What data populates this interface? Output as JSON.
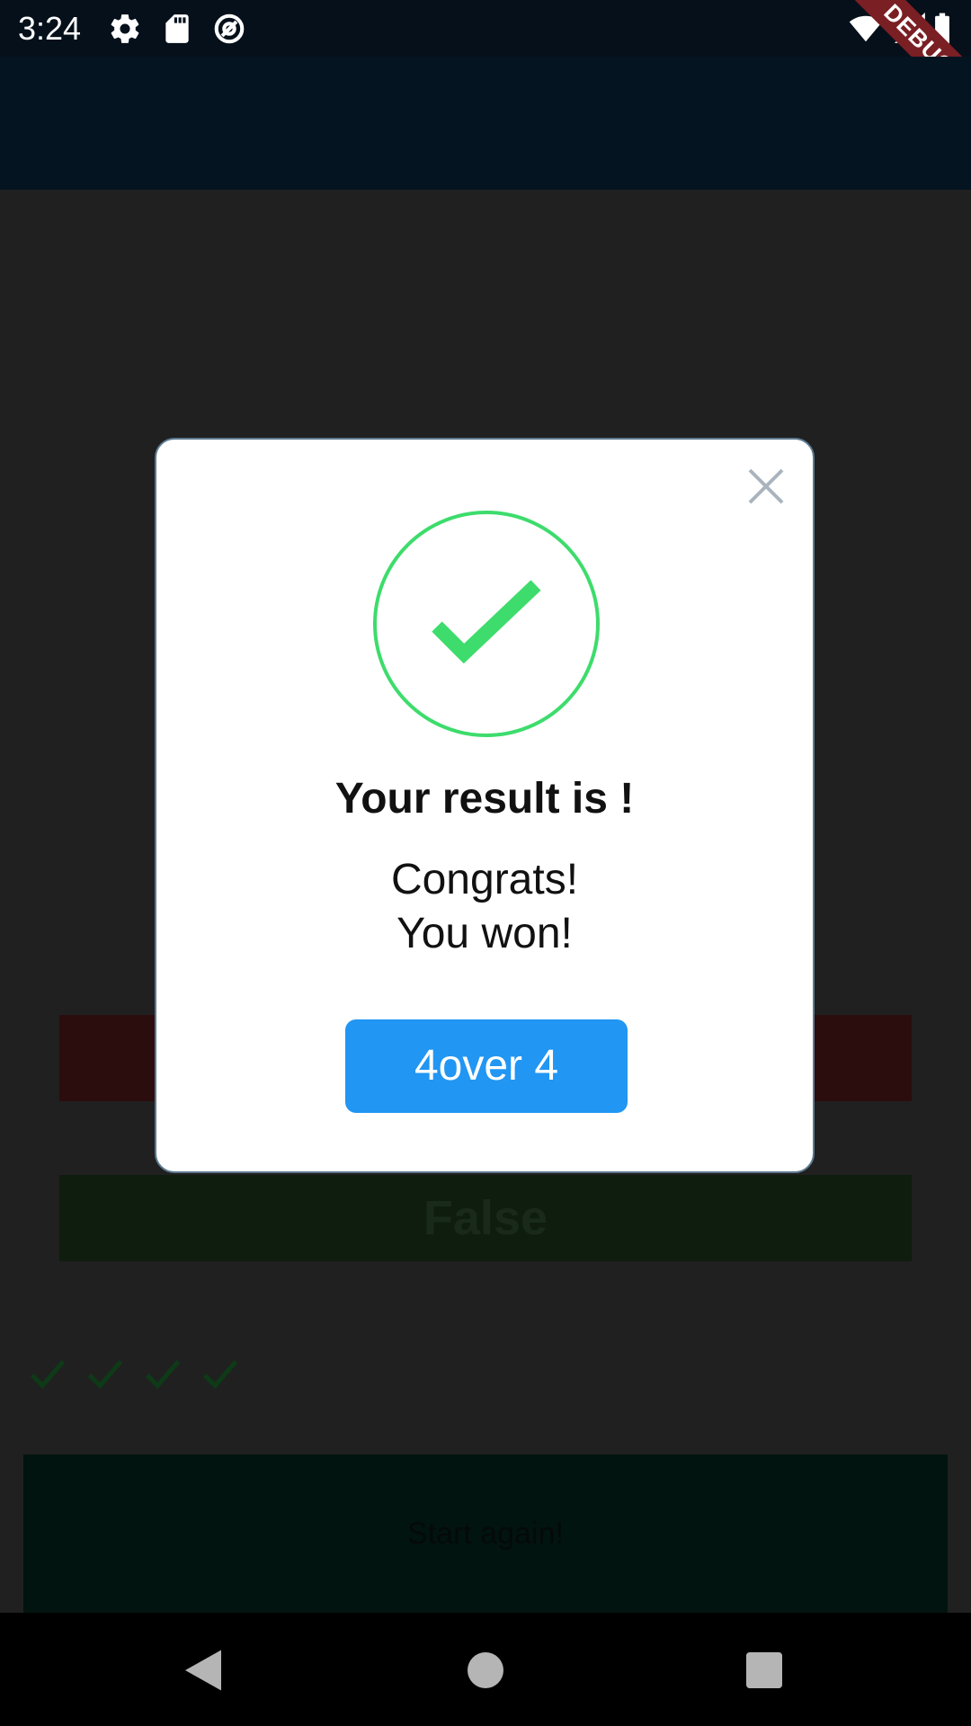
{
  "status_bar": {
    "time": "3:24",
    "icons_left": [
      "gear-icon",
      "sd-card-icon",
      "at-sign-icon"
    ],
    "icons_right": [
      "wifi-icon",
      "cellular-signal-icon",
      "battery-icon"
    ],
    "debug_label": "DEBUG",
    "background_color": "#06101a"
  },
  "app_bar": {
    "title": "",
    "background_color": "#041420"
  },
  "background_screen": {
    "true_button_color": "#2b0d0d",
    "false_button_label": "False",
    "score_icons": [
      "check-icon",
      "check-icon",
      "check-icon",
      "check-icon"
    ],
    "start_button_label": "Start again!"
  },
  "dialog": {
    "close_icon": "close-icon",
    "status_icon": "success-check-icon",
    "title": "Your result is !",
    "message_line1": "Congrats!",
    "message_line2": "You won!",
    "button_label": "4over 4",
    "accent_color": "#2196f3",
    "success_color": "#3ddc6c"
  },
  "nav_bar": {
    "buttons": [
      "back-icon",
      "home-icon",
      "recents-icon"
    ]
  }
}
